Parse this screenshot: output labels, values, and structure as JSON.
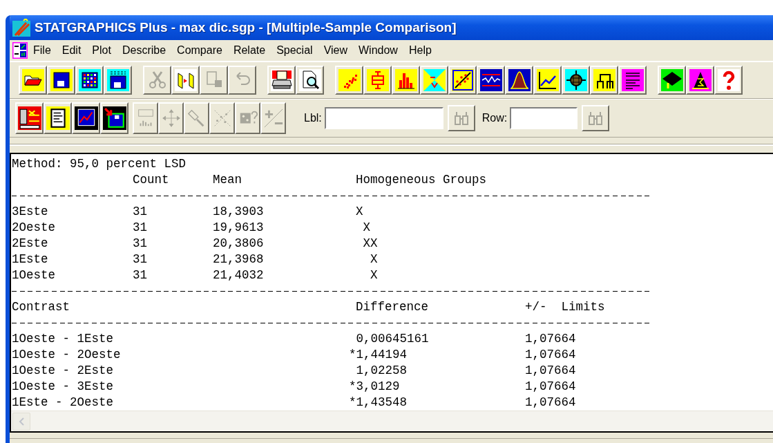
{
  "window": {
    "title": "STATGRAPHICS Plus - max dic.sgp - [Multiple-Sample Comparison]"
  },
  "menu": [
    "File",
    "Edit",
    "Plot",
    "Describe",
    "Compare",
    "Relate",
    "Special",
    "View",
    "Window",
    "Help"
  ],
  "toolbar": {
    "groups": [
      {
        "buttons": [
          {
            "kind": "open-folder",
            "disabled": false
          },
          {
            "kind": "floppy",
            "disabled": false
          },
          {
            "kind": "spreadsheet",
            "disabled": false
          },
          {
            "kind": "data-floppy",
            "disabled": false
          }
        ]
      },
      {
        "buttons": [
          {
            "kind": "scissors",
            "disabled": true
          },
          {
            "kind": "panes",
            "disabled": false
          },
          {
            "kind": "clipboard",
            "disabled": true
          },
          {
            "kind": "undo",
            "disabled": true
          }
        ]
      },
      {
        "buttons": [
          {
            "kind": "printer",
            "disabled": false
          },
          {
            "kind": "preview",
            "disabled": false
          }
        ]
      },
      {
        "buttons": [
          {
            "kind": "scatter",
            "disabled": false
          },
          {
            "kind": "boxplot",
            "disabled": false
          },
          {
            "kind": "histogram",
            "disabled": false
          },
          {
            "kind": "sigma",
            "disabled": false
          },
          {
            "kind": "regression",
            "disabled": false
          },
          {
            "kind": "control-chart",
            "disabled": false
          },
          {
            "kind": "bell-curve",
            "disabled": false
          },
          {
            "kind": "line-chart",
            "disabled": false
          },
          {
            "kind": "target",
            "disabled": false
          },
          {
            "kind": "dendrogram",
            "disabled": false
          },
          {
            "kind": "glm",
            "disabled": false
          }
        ]
      },
      {
        "buttons": [
          {
            "kind": "cap",
            "disabled": false
          },
          {
            "kind": "wizard",
            "disabled": false
          },
          {
            "kind": "help",
            "disabled": false
          }
        ]
      }
    ]
  },
  "toolbar2": {
    "buttons": [
      {
        "kind": "advisor",
        "disabled": false
      },
      {
        "kind": "document",
        "disabled": false
      },
      {
        "kind": "graph",
        "disabled": false
      },
      {
        "kind": "save-pane",
        "disabled": false
      },
      {
        "kind": "abc-chart",
        "disabled": true
      },
      {
        "kind": "move",
        "disabled": true
      },
      {
        "kind": "brush",
        "disabled": true
      },
      {
        "kind": "scatter-lines",
        "disabled": true
      },
      {
        "kind": "dice",
        "disabled": true
      },
      {
        "kind": "plus-minus",
        "disabled": true
      }
    ],
    "fields": [
      {
        "label": "Lbl:",
        "search_disabled": true
      },
      {
        "label": "Row:",
        "search_disabled": true
      }
    ]
  },
  "report": {
    "method": "Method: 95,0 percent LSD",
    "columns": [
      "Count",
      "Mean",
      "Homogeneous Groups"
    ],
    "rows": [
      {
        "name": "3Este",
        "count": "31",
        "mean": "18,3903",
        "groups": "X"
      },
      {
        "name": "2Oeste",
        "count": "31",
        "mean": "19,9613",
        "groups": " X"
      },
      {
        "name": "2Este",
        "count": "31",
        "mean": "20,3806",
        "groups": " XX"
      },
      {
        "name": "1Este",
        "count": "31",
        "mean": "21,3968",
        "groups": "  X"
      },
      {
        "name": "1Oeste",
        "count": "31",
        "mean": "21,4032",
        "groups": "  X"
      }
    ],
    "contrast_columns": [
      "Contrast",
      "Difference",
      "+/-  Limits"
    ],
    "contrasts": [
      {
        "contrast": "1Oeste - 1Este",
        "difference": " 0,00645161",
        "limits": "1,07664"
      },
      {
        "contrast": "1Oeste - 2Oeste",
        "difference": "*1,44194",
        "limits": "1,07664"
      },
      {
        "contrast": "1Oeste - 2Este",
        "difference": " 1,02258",
        "limits": "1,07664"
      },
      {
        "contrast": "1Oeste - 3Este",
        "difference": "*3,0129",
        "limits": "1,07664"
      },
      {
        "contrast": "1Este - 2Oeste",
        "difference": "*1,43548",
        "limits": "1,07664"
      }
    ]
  }
}
